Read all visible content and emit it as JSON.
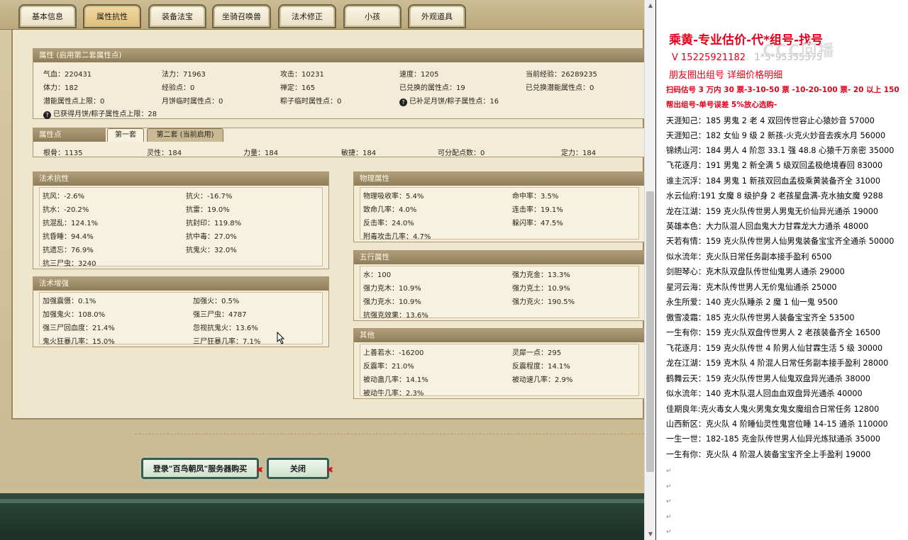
{
  "tabs": [
    "基本信息",
    "属性抗性",
    "装备法宝",
    "坐骑召唤兽",
    "法术修正",
    "小孩",
    "外观道具"
  ],
  "active_tab": 1,
  "attr": {
    "header": "属性 (启用第二套属性点)",
    "rows": [
      [
        "气血：220431",
        "法力：71963",
        "攻击：10231",
        "速度：1205",
        "当前经验：26289235"
      ],
      [
        "体力：182",
        "经验点：0",
        "禅定：165",
        "已兑换的属性点：19",
        "已兑换潜能属性点：0"
      ],
      [
        "潜能属性点上限：0",
        "月饼临时属性点：0",
        "粽子临时属性点：0",
        "已补足月饼/粽子属性点：16",
        ""
      ]
    ],
    "footer": "已获得月饼/粽子属性点上限：28"
  },
  "points": {
    "header": "属性点",
    "subtab1": "第一套",
    "subtab2": "第二套 (当前启用)",
    "values": [
      "根骨：1135",
      "灵性：184",
      "力量：184",
      "敏捷：184",
      "可分配点数：0",
      "定力：184"
    ]
  },
  "resist": {
    "header": "法术抗性",
    "rows": [
      [
        "抗风：-2.6%",
        "抗火：-16.7%"
      ],
      [
        "抗水：-20.2%",
        "抗雷：19.0%"
      ],
      [
        "抗混乱：124.1%",
        "抗封印：119.8%"
      ],
      [
        "抗昏睡：94.4%",
        "抗中毒：27.0%"
      ],
      [
        "抗遗忘：76.9%",
        "抗鬼火：32.0%"
      ],
      [
        "抗三尸虫：3240",
        ""
      ]
    ]
  },
  "boost": {
    "header": "法术增强",
    "rows": [
      [
        "加强震慑：0.1%",
        "加强火：0.5%"
      ],
      [
        "加强鬼火：108.0%",
        "强三尸虫：4787"
      ],
      [
        "强三尸回血度：21.4%",
        "忽视抗鬼火：13.6%"
      ],
      [
        "鬼火狂暴几率：15.0%",
        "三尸狂暴几率：7.1%"
      ]
    ]
  },
  "physical": {
    "header": "物理属性",
    "rows": [
      [
        "物理吸收率：5.4%",
        "命中率：3.5%"
      ],
      [
        "致命几率：4.0%",
        "连击率：19.1%"
      ],
      [
        "反击率：24.0%",
        "躲闪率：47.5%"
      ],
      [
        "附毒攻击几率：4.7%",
        ""
      ]
    ]
  },
  "elements": {
    "header": "五行属性",
    "rows": [
      [
        "水：100",
        "强力克金：13.3%"
      ],
      [
        "强力克木：10.9%",
        "强力克土：10.9%"
      ],
      [
        "强力克水：10.9%",
        "强力克火：190.5%"
      ],
      [
        "抗强克效果：13.6%",
        ""
      ]
    ]
  },
  "other": {
    "header": "其他",
    "rows": [
      [
        "上善若水：-16200",
        "灵犀一点：295"
      ],
      [
        "反震率：21.0%",
        "反震程度：14.1%"
      ],
      [
        "被动蛊几率：14.1%",
        "被动速几率：2.9%"
      ],
      [
        "被动牛几率：2.3%",
        ""
      ]
    ]
  },
  "buttons": {
    "login": "登录\"百鸟朝凤\"服务器购买",
    "close": "关闭",
    "x": "✖"
  },
  "doc": {
    "title": "乘黄-专业估价-代*组号-找号",
    "contact": "V 15225921182",
    "contact_obscured": "1*5*95355375",
    "moments": "朋友圈出组号    详细价格明细",
    "pricing1": "扫码估号 3 万内 30 票-3-10-50 票  -10-20-100 票- 20 以上 150",
    "pricing2": "帮出组号-单号误差 5%放心选购-",
    "watermark": "CCC回播",
    "listings": [
      "天涯知己：185 男鬼 2 老 4 双回传世容止心猿妙音 57000",
      "天涯知己：182 女仙 9 级 2 新孩-火克火妙音去疾水月 56000",
      "锦绣山河：184 男人 4 阶忽 33.1 强 48.8 心猿千万亲密 35000",
      "飞花逐月：191 男鬼 2 新全满 5 级双回孟极绝境春回 83000",
      "谁主沉浮：184 男鬼 1 新孩双回血孟极乘黄装备齐全 31000",
      "水云仙府:191 女魔 8 级护身 2 老孩星盘满-克水抽女魔 9288",
      "龙在江湖：159 克火队传世男人男鬼无价仙异光通杀 19000",
      "英雄本色：大力队混人回血鬼大力甘霖龙大力通杀 48000",
      "天若有情：159 克火队传世男人仙男鬼装备宝宝齐全通杀 50000",
      "似水流年：克火队日常任务副本接手盈利 6500",
      "剑胆琴心：克木队双盘队传世仙鬼男人通杀 29000",
      "星河云海：克木队传世男人无价鬼仙通杀 25000",
      "永生所爱：140 克火队睡杀 2 魔 1 仙一鬼 9500",
      "傲雪凌霜：185 克火队传世男人装备宝宝齐全 53500",
      "一生有你：159 克火队双盘传世男人 2 老孩装备齐全 16500",
      "飞花逐月：159 克火队传世 4 阶男人仙甘霖生活 5 级 30000",
      "龙在江湖：159 克木队 4 阶混人日常任务副本接手盈利 28000",
      "鹤舞云天：159 克火队传世男人仙鬼双盘异光通杀 38000",
      "似水流年：140 克木队混人回血血双盘异光通杀 40000",
      "佳期良年:克火毒女人鬼火男鬼女鬼女魔组合日常任务 12800",
      "山西新区：克火队 4 阶睡仙灵性鬼宫位睡 14-15 通杀 110000",
      "一生一世：182-185 克金队传世男人仙异光炼狱通杀 35000",
      "一生有你：克火队 4 阶混人装备宝宝齐全上手盈利 19000"
    ]
  },
  "colors": {
    "accent_red": "#e4001b",
    "section_header": "#9a8763",
    "panel_bg": "#efe6ce"
  }
}
